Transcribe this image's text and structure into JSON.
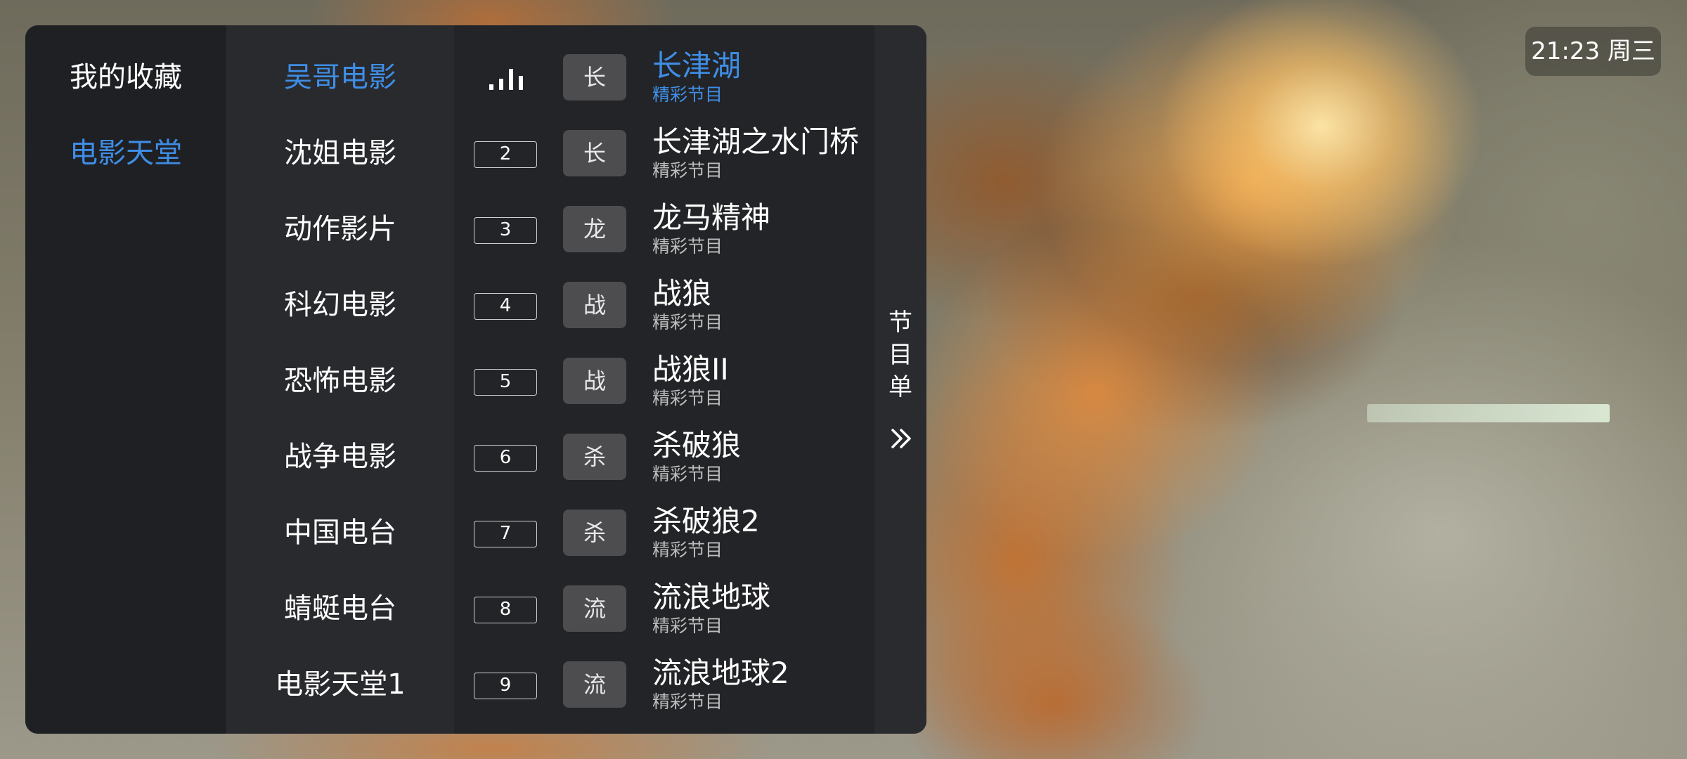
{
  "clock": {
    "time": "21:23",
    "weekday": "周三"
  },
  "categories": [
    {
      "label": "我的收藏",
      "active": false
    },
    {
      "label": "电影天堂",
      "active": true
    }
  ],
  "channels": [
    {
      "name": "吴哥电影",
      "number": "",
      "logo_char": "长",
      "program": "长津湖",
      "program_sub": "精彩节目",
      "active": true
    },
    {
      "name": "沈姐电影",
      "number": "2",
      "logo_char": "长",
      "program": "长津湖之水门桥",
      "program_sub": "精彩节目",
      "active": false
    },
    {
      "name": "动作影片",
      "number": "3",
      "logo_char": "龙",
      "program": "龙马精神",
      "program_sub": "精彩节目",
      "active": false
    },
    {
      "name": "科幻电影",
      "number": "4",
      "logo_char": "战",
      "program": "战狼",
      "program_sub": "精彩节目",
      "active": false
    },
    {
      "name": "恐怖电影",
      "number": "5",
      "logo_char": "战",
      "program": "战狼II",
      "program_sub": "精彩节目",
      "active": false
    },
    {
      "name": "战争电影",
      "number": "6",
      "logo_char": "杀",
      "program": "杀破狼",
      "program_sub": "精彩节目",
      "active": false
    },
    {
      "name": "中国电台",
      "number": "7",
      "logo_char": "杀",
      "program": "杀破狼2",
      "program_sub": "精彩节目",
      "active": false
    },
    {
      "name": "蜻蜓电台",
      "number": "8",
      "logo_char": "流",
      "program": "流浪地球",
      "program_sub": "精彩节目",
      "active": false
    },
    {
      "name": "电影天堂1",
      "number": "9",
      "logo_char": "流",
      "program": "流浪地球2",
      "program_sub": "精彩节目",
      "active": false
    }
  ],
  "side_panel": {
    "label_chars": [
      "节",
      "目",
      "单"
    ],
    "icon": "double-chevron-right-icon"
  },
  "playing_indicator_icon": "signal-bars-icon",
  "colors": {
    "accent": "#3f8ee6",
    "panel_bg": "#232427"
  }
}
